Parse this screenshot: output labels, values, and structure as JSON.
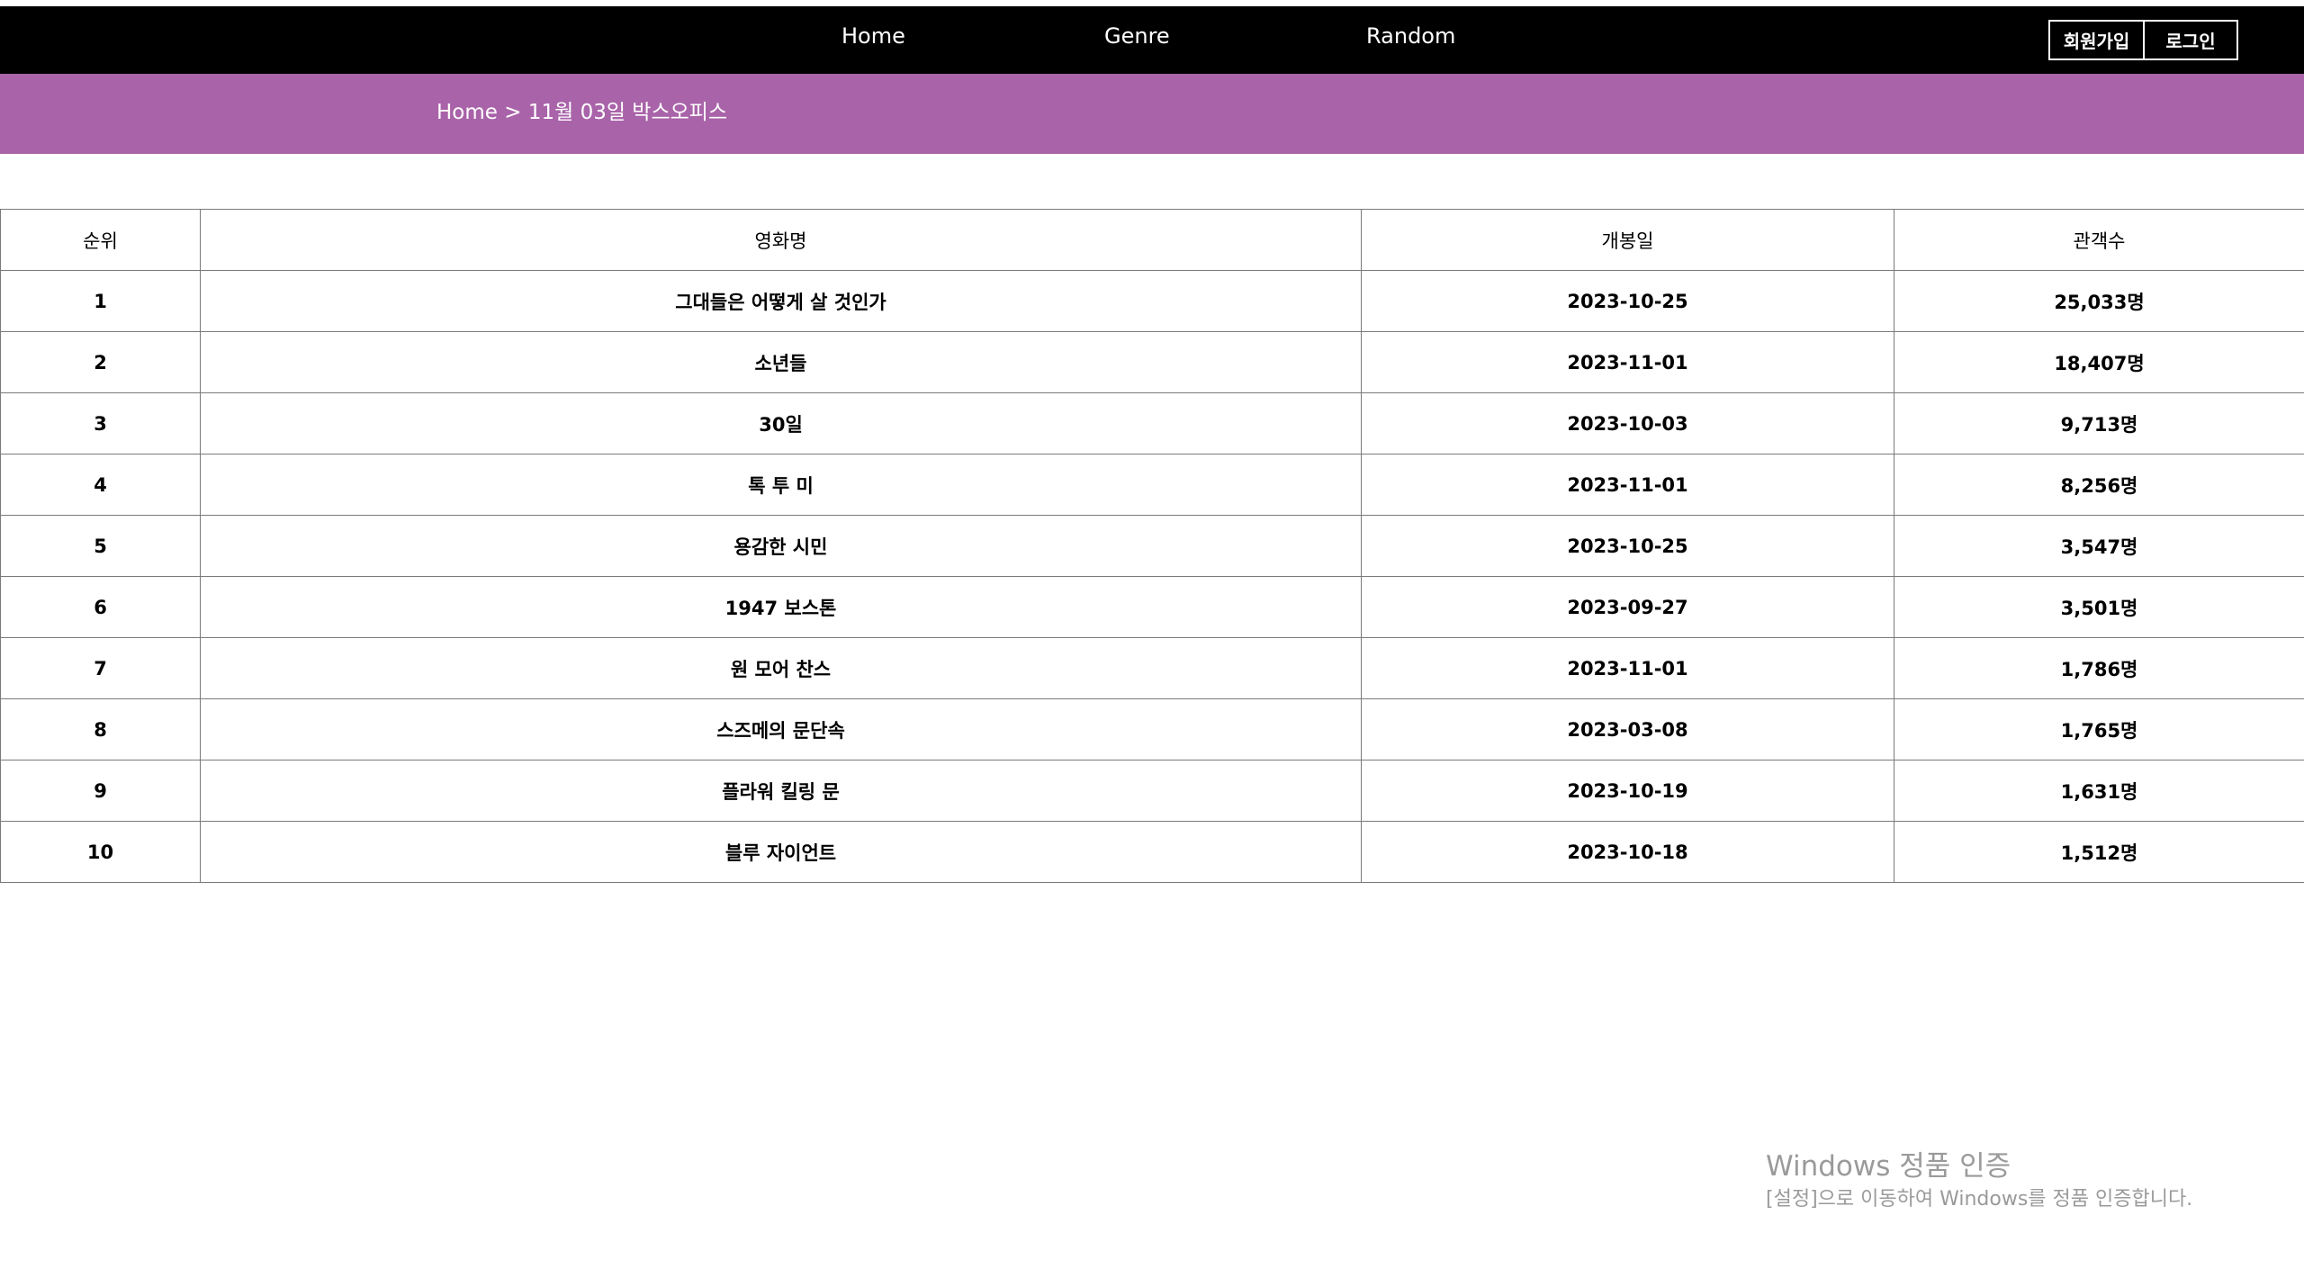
{
  "nav": {
    "home": "Home",
    "genre": "Genre",
    "random": "Random",
    "signup": "회원가입",
    "login": "로그인"
  },
  "breadcrumb": {
    "home": "Home",
    "separator": " > ",
    "current": "11월 03일 박스오피스"
  },
  "table": {
    "headers": {
      "rank": "순위",
      "title": "영화명",
      "release": "개봉일",
      "audience": "관객수"
    },
    "rows": [
      {
        "rank": "1",
        "title": "그대들은 어떻게 살 것인가",
        "release": "2023-10-25",
        "audience": "25,033명"
      },
      {
        "rank": "2",
        "title": "소년들",
        "release": "2023-11-01",
        "audience": "18,407명"
      },
      {
        "rank": "3",
        "title": "30일",
        "release": "2023-10-03",
        "audience": "9,713명"
      },
      {
        "rank": "4",
        "title": "톡 투 미",
        "release": "2023-11-01",
        "audience": "8,256명"
      },
      {
        "rank": "5",
        "title": "용감한 시민",
        "release": "2023-10-25",
        "audience": "3,547명"
      },
      {
        "rank": "6",
        "title": "1947 보스톤",
        "release": "2023-09-27",
        "audience": "3,501명"
      },
      {
        "rank": "7",
        "title": "원 모어 찬스",
        "release": "2023-11-01",
        "audience": "1,786명"
      },
      {
        "rank": "8",
        "title": "스즈메의 문단속",
        "release": "2023-03-08",
        "audience": "1,765명"
      },
      {
        "rank": "9",
        "title": "플라워 킬링 문",
        "release": "2023-10-19",
        "audience": "1,631명"
      },
      {
        "rank": "10",
        "title": "블루 자이언트",
        "release": "2023-10-18",
        "audience": "1,512명"
      }
    ]
  },
  "watermark": {
    "title": "Windows 정품 인증",
    "subtitle": "[설정]으로 이동하여 Windows를 정품 인증합니다."
  },
  "colors": {
    "nav_bg": "#000000",
    "breadcrumb_bg": "#a963a9",
    "page_bg": "#ffffff"
  }
}
